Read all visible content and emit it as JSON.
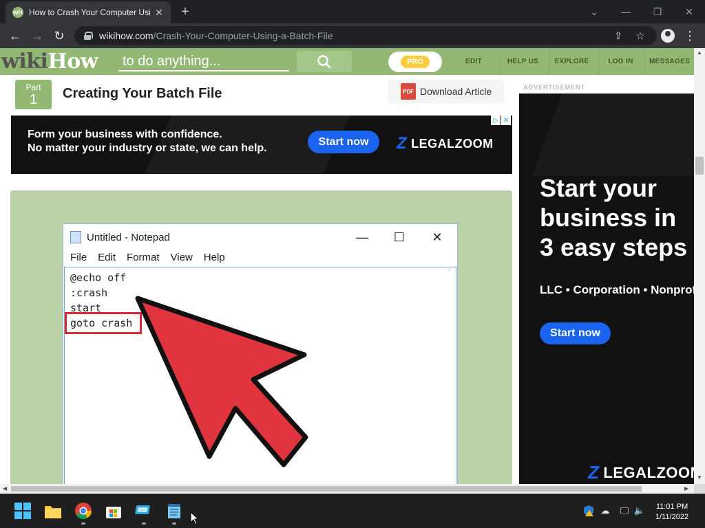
{
  "browser": {
    "tab_title": "How to Crash Your Computer Using a Batch File",
    "tab_favicon_text": "wH",
    "url_host": "wikihow.com",
    "url_path": "/Crash-Your-Computer-Using-a-Batch-File"
  },
  "wikihow": {
    "logo_wiki": "wiki",
    "logo_how": "How",
    "search_placeholder": "to do anything...",
    "pro_label": "PRO",
    "nav": [
      "EDIT",
      "HELP US",
      "EXPLORE",
      "LOG IN",
      "MESSAGES"
    ],
    "accent_color": "#93b874"
  },
  "article": {
    "part_label": "Part",
    "part_number": "1",
    "section_title": "Creating Your Batch File",
    "download_label": "Download Article",
    "pdf_icon_text": "PDF"
  },
  "banner_ad": {
    "line1": "Form your business with confidence.",
    "line2": "No matter your industry or state, we can help.",
    "button": "Start now",
    "brand": "LEGALZOOM",
    "brand_mark": "Z"
  },
  "notepad": {
    "title": "Untitled - Notepad",
    "menu": [
      "File",
      "Edit",
      "Format",
      "View",
      "Help"
    ],
    "lines": [
      "@echo off",
      ":crash",
      "start",
      "goto crash"
    ],
    "highlight_color": "#d8283a"
  },
  "side_ad": {
    "label": "ADVERTISEMENT",
    "headline": "Start your\nbusiness in\n3 easy steps",
    "subline": "LLC • Corporation • Nonprofit",
    "button": "Start now",
    "brand": "LEGALZOOM",
    "brand_mark": "Z"
  },
  "taskbar": {
    "time": "11:01 PM",
    "date": "1/11/2022"
  }
}
